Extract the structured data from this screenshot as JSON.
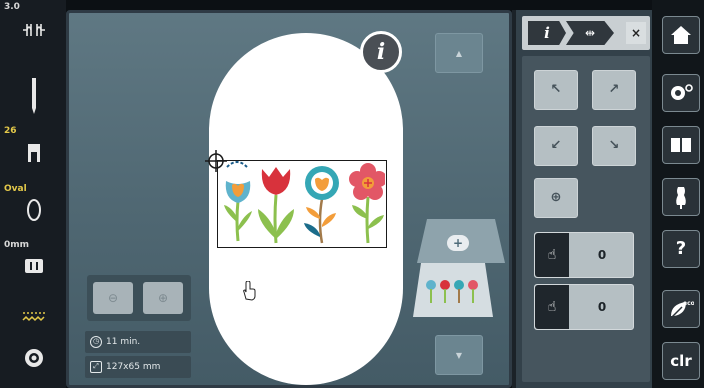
{
  "left_bar": {
    "needle_label": "3.0",
    "stitch_label": "26",
    "hoop_label": "Oval",
    "mm_label": "0mm"
  },
  "main": {
    "info_button_label": "i",
    "stats": {
      "time": "11 min.",
      "size": "127x65 mm"
    }
  },
  "right_panel": {
    "tabs": [
      {
        "label": "i"
      },
      {
        "label": "⇹"
      }
    ],
    "close_label": "×",
    "move_buttons": [
      "↖",
      "↗",
      "↙",
      "↘"
    ],
    "center_button": "⊕",
    "values": [
      {
        "value": "0"
      },
      {
        "value": "0"
      }
    ]
  },
  "nav": {
    "clr_label": "clr",
    "help_label": "?"
  },
  "colors": {
    "flower_red": "#d8323c",
    "flower_teal": "#35a7b5",
    "flower_orange": "#f39d3a",
    "flower_pink": "#e25766",
    "stem_green": "#8cc04e"
  }
}
